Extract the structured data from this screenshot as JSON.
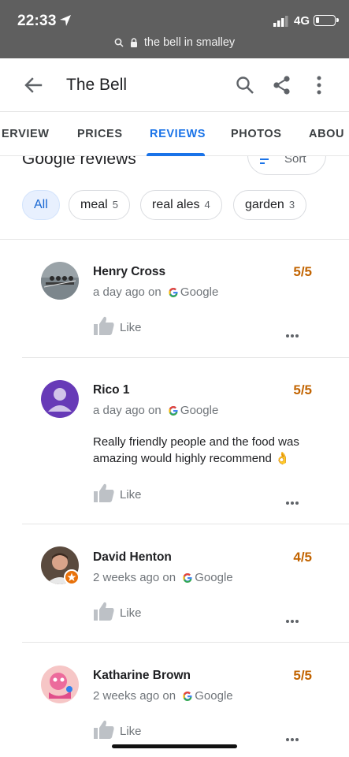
{
  "status": {
    "time": "22:33",
    "network": "4G",
    "url": "the bell in smalley"
  },
  "header": {
    "title": "The Bell"
  },
  "tabs": [
    {
      "label": "ERVIEW"
    },
    {
      "label": "PRICES"
    },
    {
      "label": "REVIEWS",
      "active": true
    },
    {
      "label": "PHOTOS"
    },
    {
      "label": "ABOU"
    }
  ],
  "reviews_section": {
    "title": "Google reviews",
    "sort_label": "Sort"
  },
  "filters": [
    {
      "label": "All",
      "count": "",
      "active": true
    },
    {
      "label": "meal",
      "count": "5"
    },
    {
      "label": "real ales",
      "count": "4"
    },
    {
      "label": "garden",
      "count": "3"
    }
  ],
  "source_label": "Google",
  "like_label": "Like",
  "reviews": [
    {
      "name": "Henry Cross",
      "time": "a day ago on",
      "rating": "5/5",
      "text": "",
      "avatar": "rowing-photo"
    },
    {
      "name": "Rico 1",
      "time": "a day ago on",
      "rating": "5/5",
      "text": "Really friendly people and the food was amazing would highly recommend 👌",
      "avatar": "default-person-purple"
    },
    {
      "name": "David Henton",
      "time": "2 weeks ago on",
      "rating": "4/5",
      "text": "",
      "avatar": "man-photo-local-guide"
    },
    {
      "name": "Katharine Brown",
      "time": "2 weeks ago on",
      "rating": "5/5",
      "text": "",
      "avatar": "pink-character-photo"
    }
  ],
  "colors": {
    "accent": "#1a73e8",
    "rating": "#c26401",
    "statusbar": "#5f5f5f",
    "avatar_default": "#673ab7"
  }
}
